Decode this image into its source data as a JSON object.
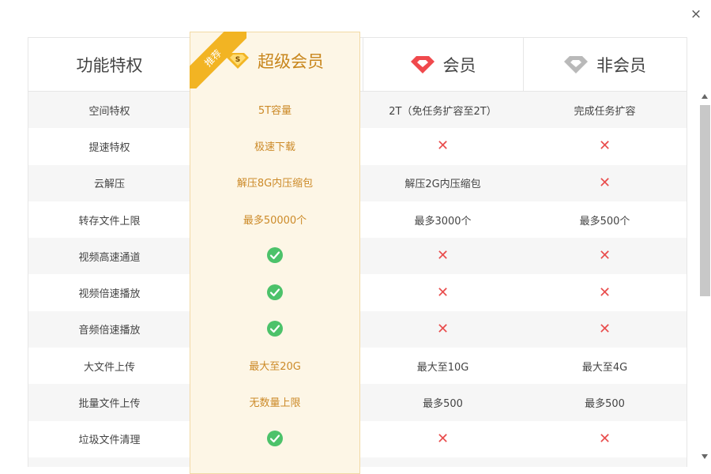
{
  "close_label": "×",
  "ribbon_label": "推荐",
  "columns": {
    "feature": "功能特权",
    "super": "超级会员",
    "vip": "会员",
    "non": "非会员"
  },
  "rows": [
    {
      "feature": "空间特权",
      "super": "5T容量",
      "vip": "2T（免任务扩容至2T）",
      "non": "完成任务扩容"
    },
    {
      "feature": "提速特权",
      "super": "极速下载",
      "vip": "✕",
      "non": "✕"
    },
    {
      "feature": "云解压",
      "super": "解压8G内压缩包",
      "vip": "解压2G内压缩包",
      "non": "✕"
    },
    {
      "feature": "转存文件上限",
      "super": "最多50000个",
      "vip": "最多3000个",
      "non": "最多500个"
    },
    {
      "feature": "视频高速通道",
      "super": "check",
      "vip": "✕",
      "non": "✕"
    },
    {
      "feature": "视频倍速播放",
      "super": "check",
      "vip": "✕",
      "non": "✕"
    },
    {
      "feature": "音频倍速播放",
      "super": "check",
      "vip": "✕",
      "non": "✕"
    },
    {
      "feature": "大文件上传",
      "super": "最大至20G",
      "vip": "最大至10G",
      "non": "最大至4G"
    },
    {
      "feature": "批量文件上传",
      "super": "无数量上限",
      "vip": "最多500",
      "non": "最多500"
    },
    {
      "feature": "垃圾文件清理",
      "super": "check",
      "vip": "✕",
      "non": "✕"
    }
  ],
  "colors": {
    "accent_gold": "#c8861c",
    "ribbon": "#f2b423",
    "check_green": "#4cc26a",
    "cross_red": "#e94d4d",
    "vip_red": "#f0494d"
  },
  "icons": {
    "super": "gold-gem-s-icon",
    "vip": "red-gem-icon",
    "non": "gray-gem-icon",
    "check": "check-circle-icon",
    "cross": "cross-icon"
  }
}
